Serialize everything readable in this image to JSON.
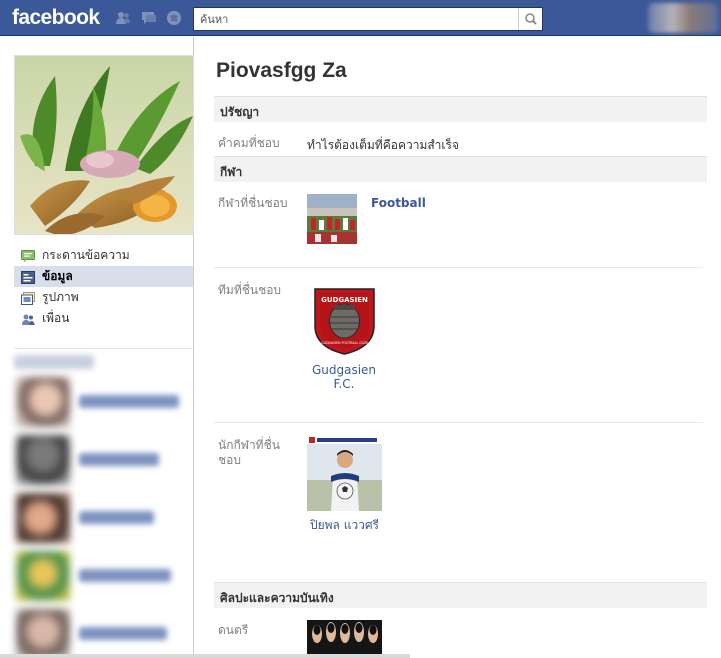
{
  "topbar": {
    "logo": "facebook",
    "search_placeholder": "ค้นหา",
    "jewels": [
      "friends-icon",
      "messages-icon",
      "notifications-icon"
    ],
    "search_icon": "search-icon"
  },
  "sidebar": {
    "nav": [
      {
        "label": "กระดานข้อความ",
        "icon": "wall-icon",
        "active": false
      },
      {
        "label": "ข้อมูล",
        "icon": "info-icon",
        "active": true
      },
      {
        "label": "รูปภาพ",
        "icon": "photos-icon",
        "active": false
      },
      {
        "label": "เพื่อน",
        "icon": "friends-icon",
        "active": false
      }
    ]
  },
  "profile": {
    "name": "Piovasfgg Za"
  },
  "sections": {
    "philosophy": {
      "title": "ปรัชญา",
      "quote_label": "คำคมที่ชอบ",
      "quote_value": "ทำไรต้องเต็มที่คือความสำเร็จ"
    },
    "sports": {
      "title": "กีฬา",
      "favorite_sports_label": "กีฬาที่ชื่นชอบ",
      "favorite_sports_value": "Football",
      "favorite_teams_label": "ทีมที่ชื่นชอบ",
      "favorite_team_name": "Gudgasien F.C.",
      "favorite_team_logo_text": "GUDGASIEN",
      "favorite_team_logo_sub": "GUDGASIEN FOOTBALL CLUB",
      "favorite_athletes_label": "นักกีฬาที่ชื่นชอบ",
      "favorite_athlete_name": "ปิยพล แววศรี"
    },
    "arts": {
      "title": "ศิลปะและความบันเทิง",
      "music_label": "ดนตรี"
    }
  },
  "colors": {
    "brand": "#3b5998",
    "link": "#3b5998",
    "section_bg": "#f2f2f2",
    "active_nav": "#d8dfea"
  }
}
